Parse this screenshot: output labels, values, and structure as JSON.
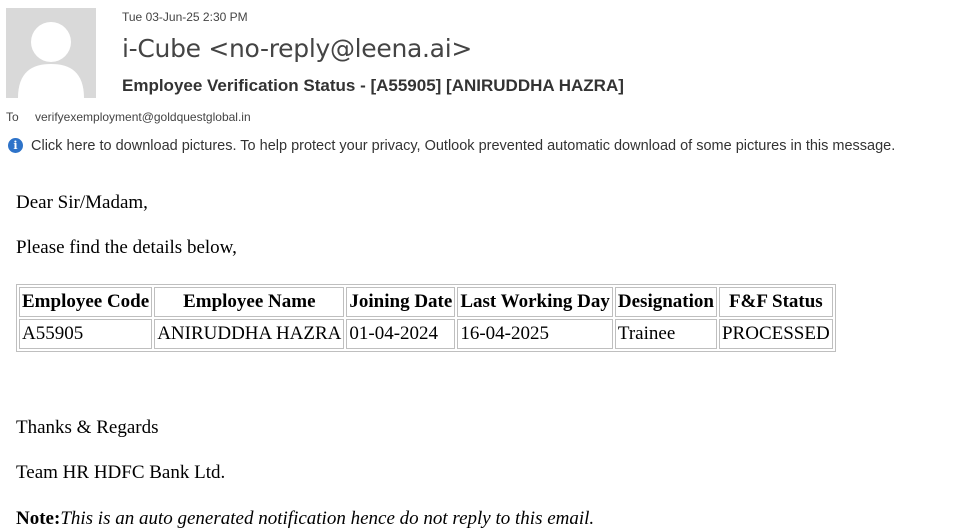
{
  "header": {
    "sent_date": "Tue 03-Jun-25 2:30 PM",
    "sender": "i-Cube <no-reply@leena.ai>",
    "subject": "Employee Verification Status - [A55905] [ANIRUDDHA  HAZRA]",
    "to_label": "To",
    "to_address": "verifyexemployment@goldquestglobal.in",
    "avatar_icon": "person-placeholder-icon"
  },
  "info_bar": {
    "icon": "info-icon",
    "text": "Click here to download pictures. To help protect your privacy, Outlook prevented automatic download of some pictures in this message."
  },
  "body": {
    "greeting": "Dear Sir/Madam,",
    "intro": "Please find the details below,",
    "table": {
      "headers": [
        "Employee Code",
        "Employee Name",
        "Joining Date",
        "Last Working Day",
        "Designation",
        "F&F Status"
      ],
      "rows": [
        [
          "A55905",
          "ANIRUDDHA HAZRA",
          "01-04-2024",
          "16-04-2025",
          "Trainee",
          "PROCESSED"
        ]
      ]
    },
    "regards": "Thanks & Regards",
    "team": "Team HR HDFC Bank Ltd.",
    "note_label": "Note:",
    "note_text": "This is an auto generated notification hence do not reply to this email."
  },
  "colors": {
    "avatar_bg": "#d9d9d9",
    "info_icon": "#2e73c9",
    "table_border": "#bfbfbf"
  }
}
